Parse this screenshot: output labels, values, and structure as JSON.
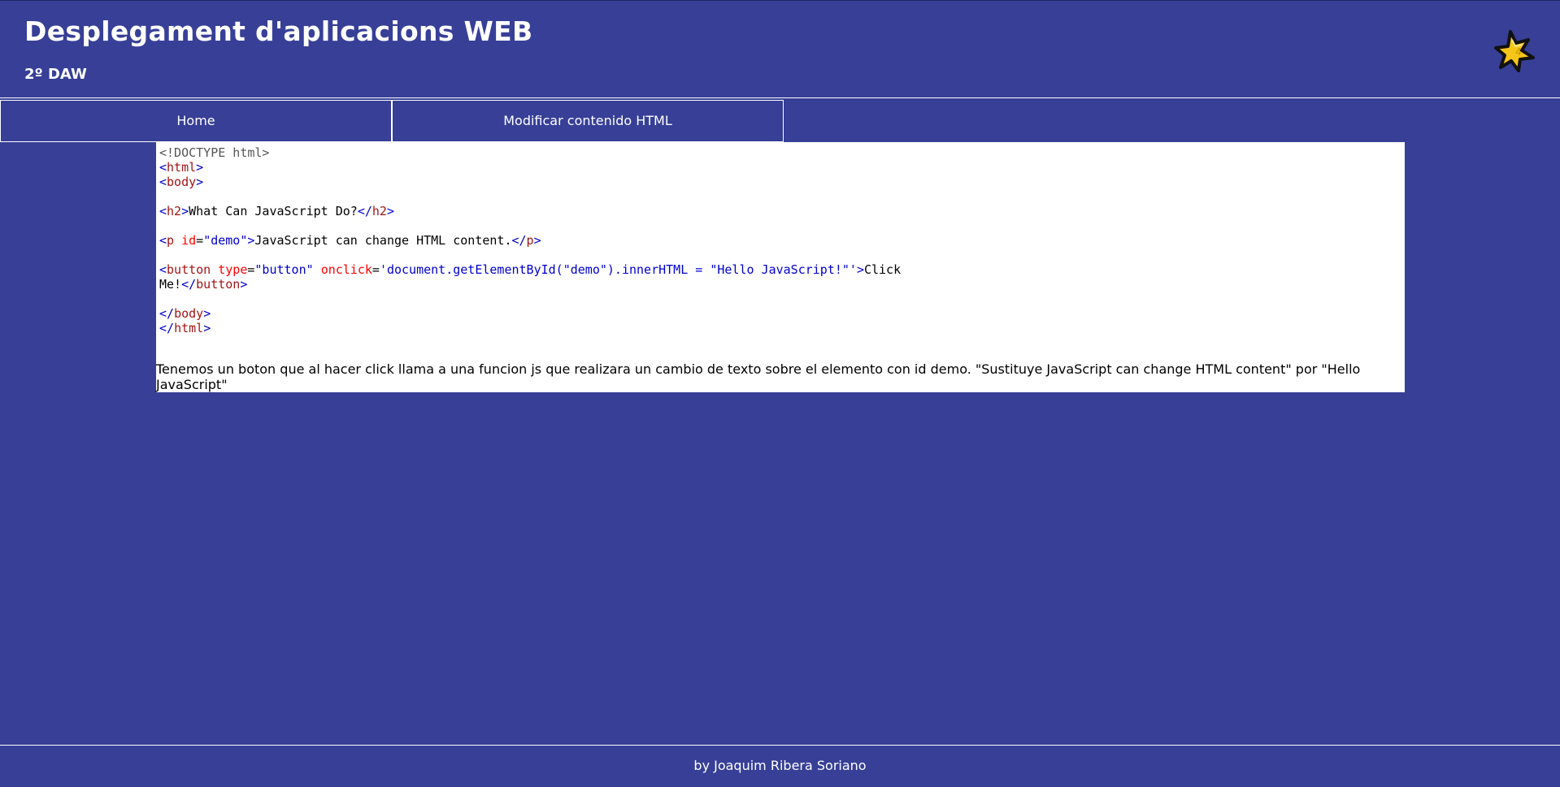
{
  "header": {
    "title": "Desplegament d'aplicacions WEB",
    "subtitle": "2º DAW",
    "logo_icon": "star-logo-icon"
  },
  "nav": {
    "items": [
      {
        "label": "Home"
      },
      {
        "label": "Modificar contenido HTML"
      }
    ]
  },
  "code": {
    "doctype": "<!DOCTYPE html>",
    "h2_text": "What Can JavaScript Do?",
    "p_id": "\"demo\"",
    "p_text": "JavaScript can change HTML content.",
    "button_type": "\"button\"",
    "onclick_value": "'document.getElementById(\"demo\").innerHTML = \"Hello JavaScript!\"'",
    "button_text_1": "Click",
    "button_text_2": "Me!"
  },
  "description": "Tenemos un boton que al hacer click llama a una funcion js que realizara un cambio de texto sobre el elemento con id demo. \"Sustituye JavaScript can change HTML content\" por \"Hello JavaScript\"",
  "footer": {
    "text": "by Joaquim Ribera Soriano"
  },
  "colors": {
    "background": "#373f97",
    "tag": "#a31515",
    "attribute": "#ff0000",
    "value": "#0000cd"
  }
}
